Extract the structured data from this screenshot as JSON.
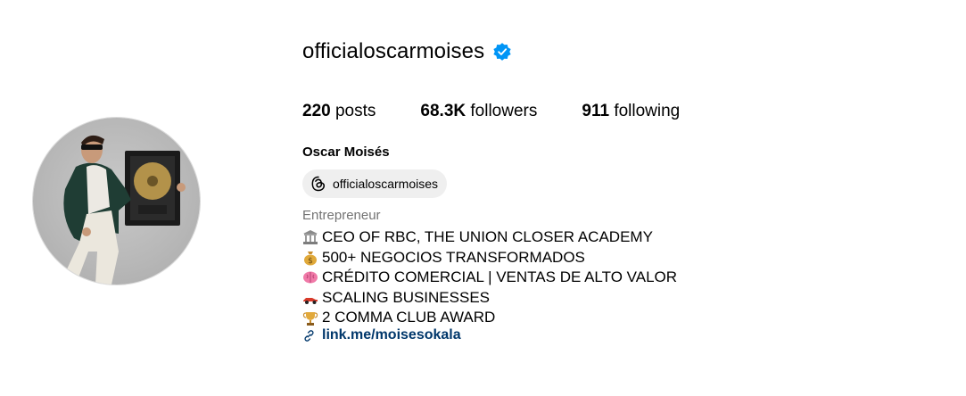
{
  "profile": {
    "username": "officialoscarmoises",
    "verified_icon": "verified-badge-icon",
    "full_name": "Oscar Moisés",
    "threads_handle": "officialoscarmoises",
    "category": "Entrepreneur",
    "link": "link.me/moisesokala"
  },
  "stats": {
    "posts_count": "220",
    "posts_label": "posts",
    "followers_count": "68.3K",
    "followers_label": "followers",
    "following_count": "911",
    "following_label": "following"
  },
  "bio": {
    "lines": [
      {
        "icon": "classical-building-icon",
        "text": "CEO OF RBC, THE UNION CLOSER ACADEMY"
      },
      {
        "icon": "money-bag-icon",
        "text": "500+ NEGOCIOS TRANSFORMADOS"
      },
      {
        "icon": "brain-icon",
        "text": "CRÉDITO COMERCIAL | VENTAS DE ALTO VALOR"
      },
      {
        "icon": "race-car-icon",
        "text": "SCALING BUSINESSES"
      },
      {
        "icon": "trophy-icon",
        "text": "2 COMMA CLUB AWARD"
      }
    ]
  },
  "colors": {
    "verified": "#0095f6",
    "link": "#00376b",
    "category": "#737373",
    "pill_bg": "#efefef"
  }
}
